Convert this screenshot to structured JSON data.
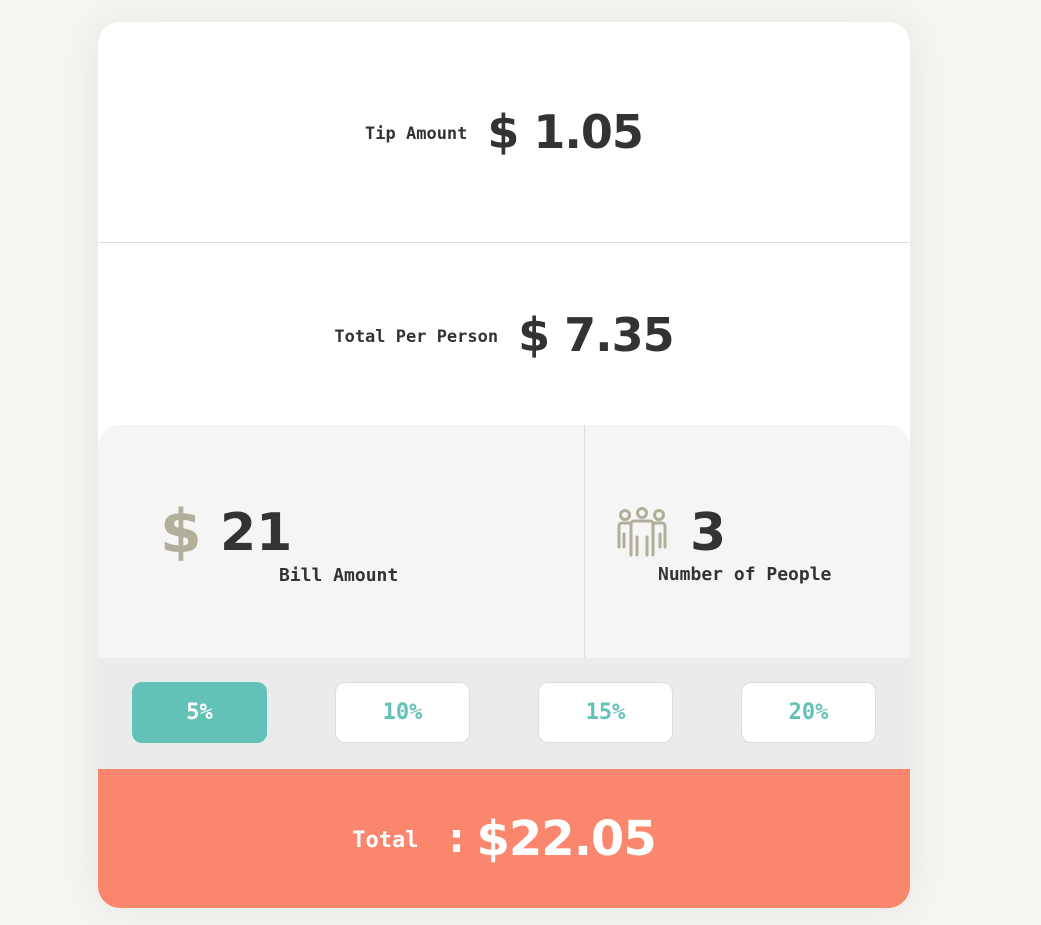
{
  "results": {
    "tip_amount_label": "Tip Amount",
    "tip_amount_value": "$ 1.05",
    "per_person_label": "Total Per Person",
    "per_person_value": "$ 7.35"
  },
  "inputs": {
    "bill_icon": "dollar-icon",
    "bill_icon_glyph": "$",
    "bill_value": "21",
    "bill_label": "Bill Amount",
    "people_icon": "people-icon",
    "people_value": "3",
    "people_label": "Number of People"
  },
  "tip_options": [
    {
      "label": "5%",
      "selected": true
    },
    {
      "label": "10%",
      "selected": false
    },
    {
      "label": "15%",
      "selected": false
    },
    {
      "label": "20%",
      "selected": false
    }
  ],
  "total": {
    "label": "Total",
    "separator": ":",
    "value": "$22.05"
  },
  "colors": {
    "accent_teal": "#62c2b7",
    "total_bar": "#fa866d",
    "icon_muted": "#b1ae9c",
    "text_dark": "#333333"
  }
}
